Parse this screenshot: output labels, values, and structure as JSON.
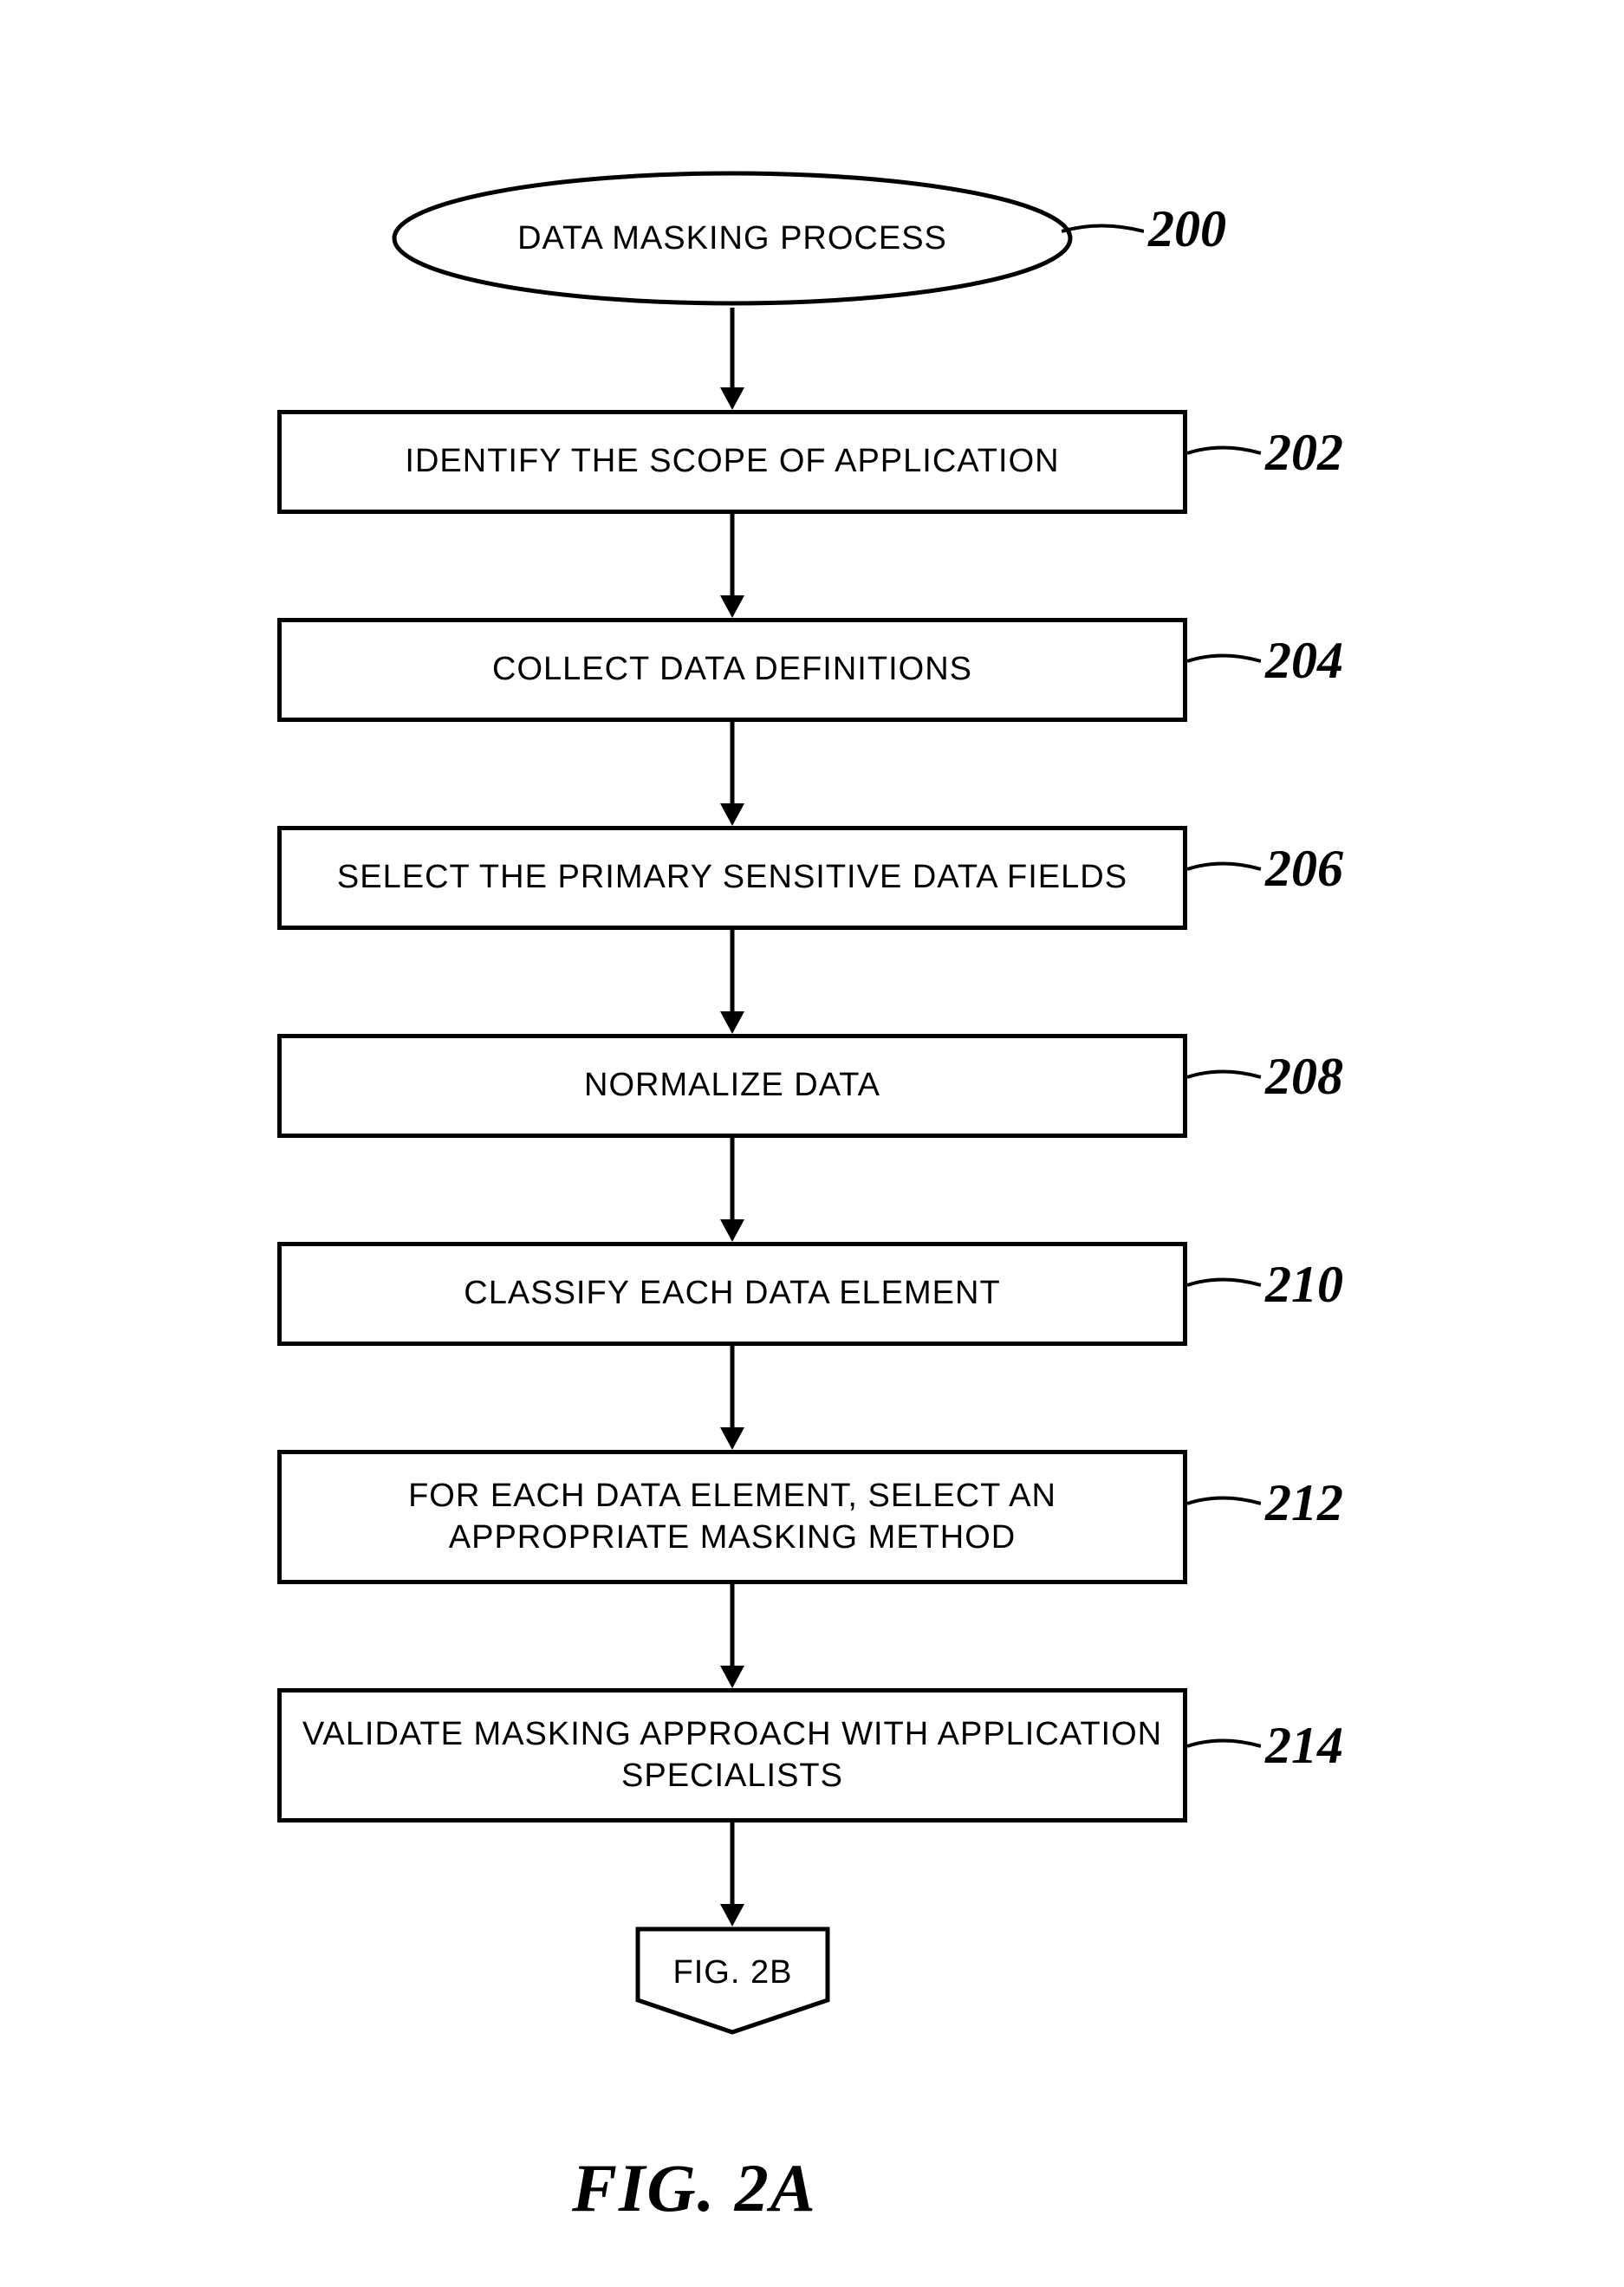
{
  "flow": {
    "start": "DATA MASKING PROCESS",
    "steps": {
      "s1": "IDENTIFY THE SCOPE OF APPLICATION",
      "s2": "COLLECT DATA DEFINITIONS",
      "s3": "SELECT THE PRIMARY SENSITIVE DATA FIELDS",
      "s4": "NORMALIZE DATA",
      "s5": "CLASSIFY EACH DATA ELEMENT",
      "s6": "FOR EACH DATA ELEMENT, SELECT AN APPROPRIATE MASKING METHOD",
      "s7": "VALIDATE MASKING APPROACH WITH APPLICATION SPECIALISTS"
    },
    "offpage": "FIG. 2B"
  },
  "refs": {
    "r0": "200",
    "r1": "202",
    "r2": "204",
    "r3": "206",
    "r4": "208",
    "r5": "210",
    "r6": "212",
    "r7": "214"
  },
  "caption": "FIG.  2A"
}
